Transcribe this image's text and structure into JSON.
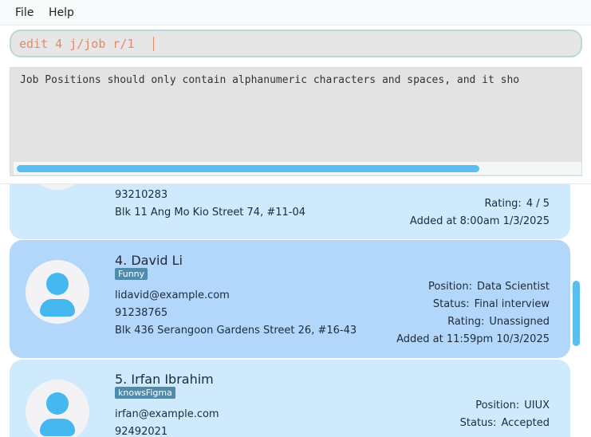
{
  "menu": {
    "file": "File",
    "help": "Help"
  },
  "command": {
    "value": "edit 4 j/job r/1"
  },
  "result": {
    "text": "Job Positions should only contain alphanumeric characters and spaces, and it sho"
  },
  "cards": [
    {
      "phone": "93210283",
      "address": "Blk 11 Ang Mo Kio Street 74, #11-04",
      "rating_key": "Rating:",
      "rating": "4 / 5",
      "added": "Added at 8:00am 1/3/2025"
    },
    {
      "name": "4. David Li",
      "tag": "Funny",
      "email": "lidavid@example.com",
      "phone": "91238765",
      "address": "Blk 436 Serangoon Gardens Street 26, #16-43",
      "position_key": "Position:",
      "position": "Data Scientist",
      "status_key": "Status:",
      "status": "Final interview",
      "rating_key": "Rating:",
      "rating": "Unassigned",
      "added": "Added at 11:59pm 10/3/2025"
    },
    {
      "name": "5. Irfan Ibrahim",
      "tag": "knowsFigma",
      "email": "irfan@example.com",
      "phone": "92492021",
      "position_key": "Position:",
      "position": "UIUX",
      "status_key": "Status:",
      "status": "Accepted"
    }
  ],
  "icons": {
    "avatar": "person-avatar-icon"
  },
  "colors": {
    "accent": "#5bbef1",
    "card": "#cfeafd",
    "card_selected": "#b3d7fb",
    "tag": "#4f8bab",
    "command_text": "#e08a6a"
  }
}
